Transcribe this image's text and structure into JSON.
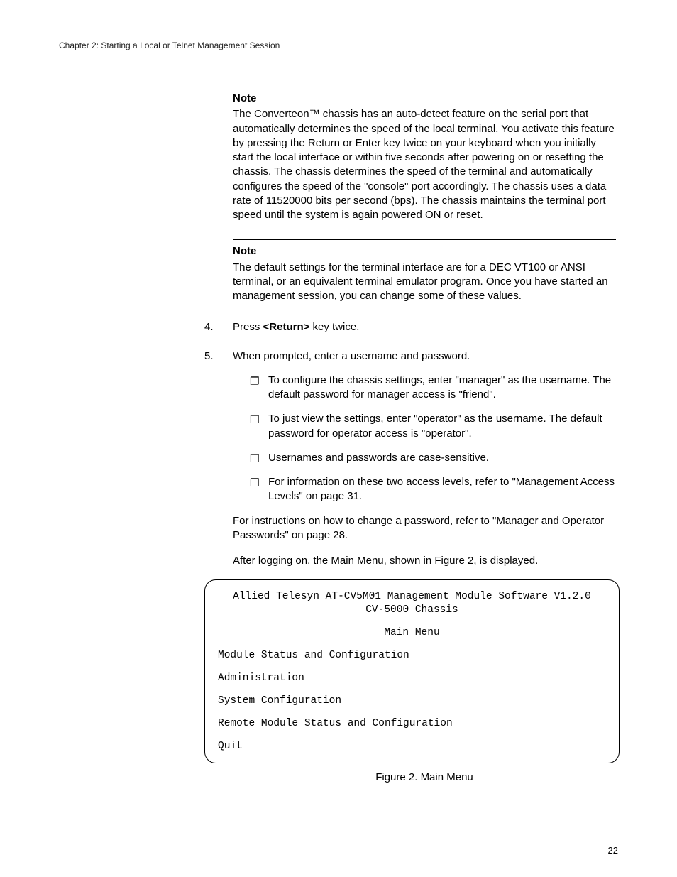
{
  "header": {
    "chapter": "Chapter 2: Starting a Local or Telnet Management Session"
  },
  "notes": [
    {
      "label": "Note",
      "body": "The Converteon™ chassis has an auto-detect feature on the serial port that automatically determines the speed of the local terminal. You activate this feature by pressing the Return or Enter key twice on your keyboard when you initially start the local interface or within five seconds after powering on or resetting the chassis. The chassis determines the speed of the terminal and automatically configures the speed of the \"console\" port accordingly. The chassis uses a data rate of 11520000 bits per second (bps). The chassis maintains the terminal port speed until the system is again powered ON or reset."
    },
    {
      "label": "Note",
      "body": "The default settings for the terminal interface are for a DEC VT100 or ANSI terminal, or an equivalent terminal emulator program. Once you have started an management session, you can change some of these values."
    }
  ],
  "steps": {
    "s4": {
      "num": "4.",
      "pre": "Press ",
      "bold": "<Return>",
      "post": " key twice."
    },
    "s5": {
      "num": "5.",
      "text": "When prompted, enter a username and password.",
      "bullets": [
        "To configure the chassis settings, enter \"manager\" as the username. The default password for manager access is \"friend\".",
        "To just view the settings, enter \"operator\" as the username. The default password for operator access is \"operator\".",
        "Usernames and passwords are case-sensitive.",
        "For information on these two access levels, refer to \"Management Access Levels\" on page 31."
      ],
      "after1": "For instructions on how to change a password, refer to \"Manager and Operator Passwords\" on page 28.",
      "after2": "After logging on, the Main Menu, shown in Figure 2, is displayed."
    }
  },
  "bullet_marker": "❐",
  "terminal": {
    "line1": "Allied Telesyn AT-CV5M01 Management Module Software V1.2.0",
    "line2": "CV-5000 Chassis",
    "line3": "Main Menu",
    "items": [
      "Module Status and Configuration",
      "Administration",
      "System Configuration",
      "Remote Module Status and Configuration",
      "Quit"
    ]
  },
  "figure_caption": "Figure 2. Main Menu",
  "page_number": "22"
}
